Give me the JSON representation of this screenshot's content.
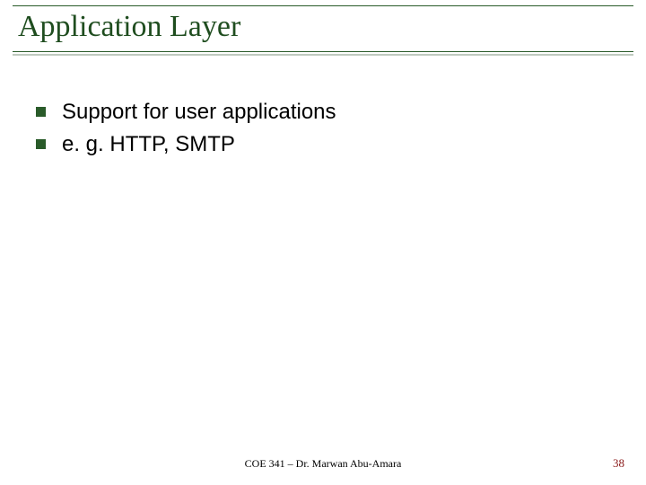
{
  "slide": {
    "title": "Application Layer",
    "bullets": [
      "Support for user applications",
      "e. g. HTTP, SMTP"
    ],
    "footer": "COE 341 – Dr. Marwan Abu-Amara",
    "page_number": "38"
  }
}
